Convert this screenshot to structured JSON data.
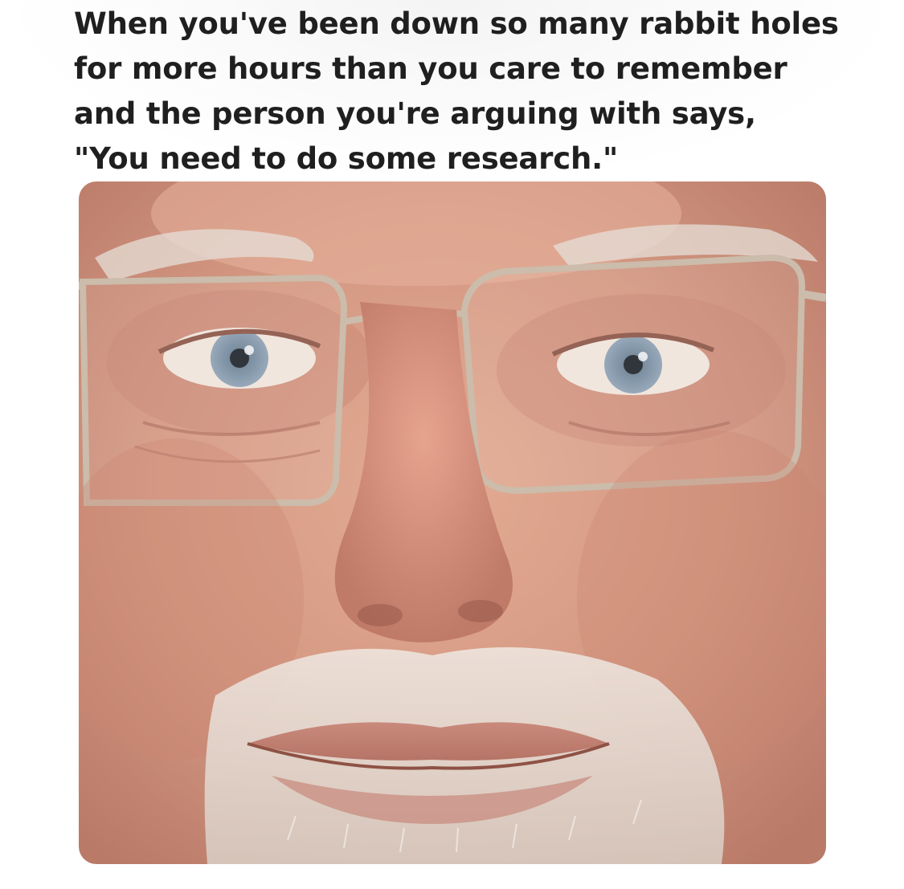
{
  "caption": {
    "lines": [
      "When you've been down so many rabbit holes",
      "for more hours than you care to remember",
      "and the person you're arguing with says,",
      "\"You need to do some research.\""
    ]
  },
  "photo": {
    "icon": "face-photo-icon",
    "colors": {
      "skin": "#d9a08a",
      "skin_shadow": "#b87462",
      "beard": "#e8e2dc",
      "iris": "#7f93a6",
      "glasses_frame": "#c9b9a8"
    }
  }
}
